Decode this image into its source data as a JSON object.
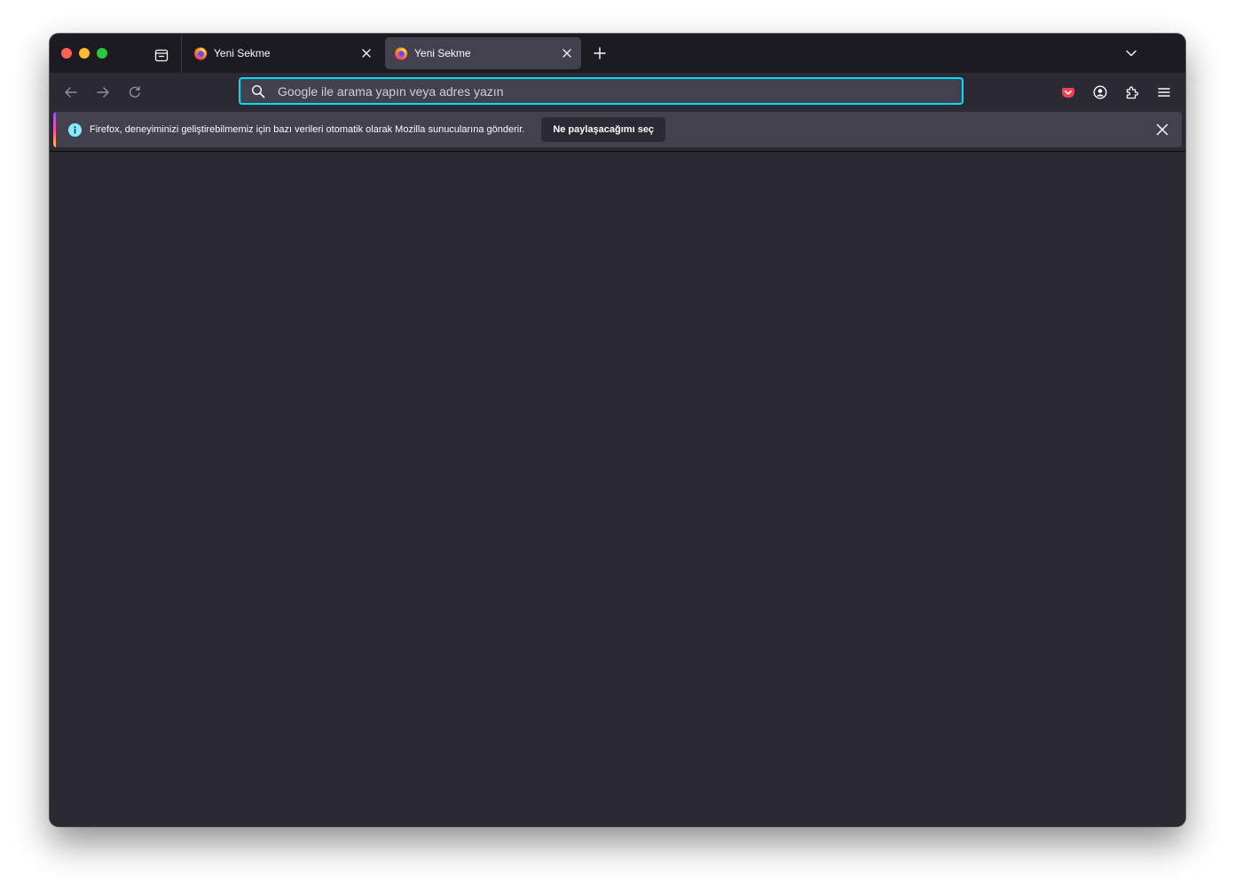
{
  "tabs": [
    {
      "label": "Yeni Sekme",
      "active": false
    },
    {
      "label": "Yeni Sekme",
      "active": true
    }
  ],
  "urlbar": {
    "placeholder": "Google ile arama yapın veya adres yazın",
    "value": ""
  },
  "notification": {
    "message": "Firefox, deneyiminizi geliştirebilmemiz için bazı verileri otomatik olarak Mozilla sunucularına gönderir.",
    "button_label": "Ne paylaşacağımı seç"
  },
  "icons": {
    "tabs_overview": "firefox-view-icon",
    "new_tab": "plus-icon",
    "tab_list": "chevron-down-icon",
    "back": "arrow-left-icon",
    "forward": "arrow-right-icon",
    "reload": "reload-icon",
    "search": "search-icon",
    "pocket": "pocket-icon",
    "account": "account-icon",
    "extensions": "puzzle-icon",
    "menu": "hamburger-menu-icon",
    "info": "info-icon",
    "close": "close-icon"
  },
  "colors": {
    "tabstrip": "#1c1b22",
    "toolbar": "#2b2a33",
    "active_tab": "#42414d",
    "urlbar_focus": "#00ddff",
    "pocket": "#ef4056",
    "info": "#80ebff"
  }
}
